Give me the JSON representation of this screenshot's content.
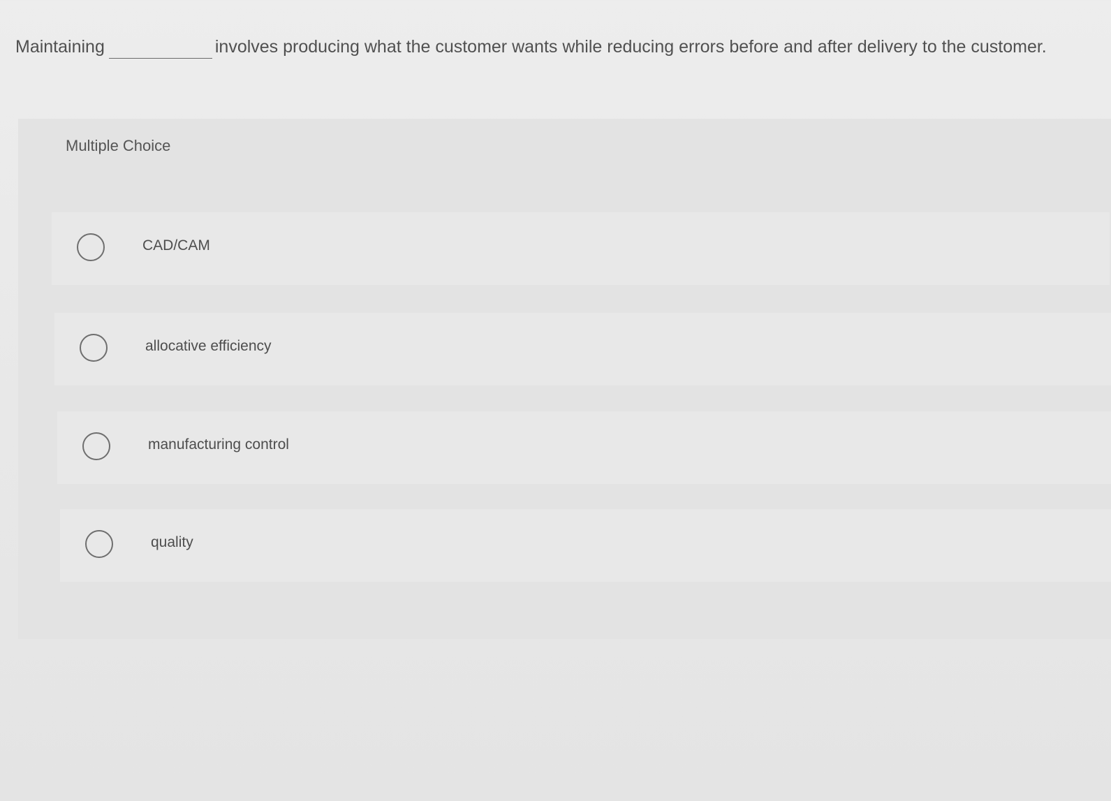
{
  "question": {
    "prefix": "Maintaining",
    "suffix": "involves producing what the customer wants while reducing errors before and after delivery to the customer."
  },
  "panel": {
    "label": "Multiple Choice",
    "options": [
      {
        "label": "CAD/CAM",
        "selected": false
      },
      {
        "label": "allocative efficiency",
        "selected": false
      },
      {
        "label": "manufacturing control",
        "selected": false
      },
      {
        "label": "quality",
        "selected": false
      }
    ]
  }
}
